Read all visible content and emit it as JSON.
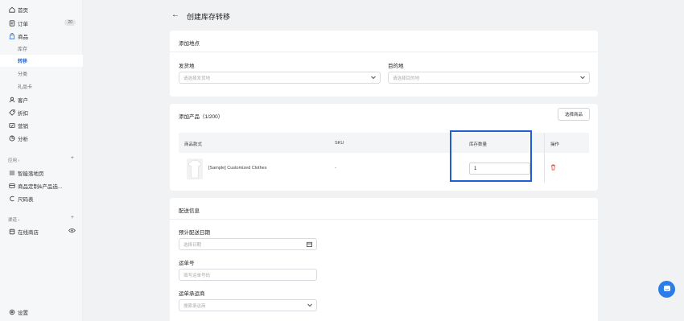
{
  "sidebar": {
    "items": [
      {
        "label": "首页",
        "icon": "home-icon"
      },
      {
        "label": "订单",
        "icon": "order-icon",
        "badge": "20"
      },
      {
        "label": "商品",
        "icon": "product-icon"
      },
      {
        "label": "库存"
      },
      {
        "label": "转移"
      },
      {
        "label": "分类"
      },
      {
        "label": "礼品卡"
      },
      {
        "label": "客户",
        "icon": "customer-icon"
      },
      {
        "label": "折扣",
        "icon": "discount-icon"
      },
      {
        "label": "营销",
        "icon": "marketing-icon"
      },
      {
        "label": "分析",
        "icon": "analytics-icon"
      }
    ],
    "apps_label": "应用 ›",
    "apps": [
      {
        "label": "智能落地页",
        "icon": "landing-page-icon"
      },
      {
        "label": "商品定制&产品选...",
        "icon": "customize-icon"
      },
      {
        "label": "尺码表",
        "icon": "size-chart-icon"
      }
    ],
    "channels_label": "渠道 ›",
    "channels": [
      {
        "label": "在线商店",
        "icon": "store-icon"
      }
    ],
    "settings_label": "设置",
    "active_color": "#1f6ee8"
  },
  "header": {
    "title": "创建库存转移"
  },
  "locations": {
    "title": "添加地点",
    "origin_label": "发货地",
    "origin_placeholder": "请选择发货地",
    "destination_label": "目的地",
    "destination_placeholder": "请选择目的地"
  },
  "products": {
    "title": "添加产品（1/200）",
    "select_button": "选择商品",
    "columns": [
      "商品款式",
      "SKU",
      "库存数量",
      "操作"
    ],
    "rows": [
      {
        "name": "[Sample] Customized Clothes",
        "sku": "-",
        "quantity": "1"
      }
    ]
  },
  "shipping": {
    "title": "配送信息",
    "date_label": "预计配送日期",
    "date_placeholder": "选择日期",
    "tracking_label": "运单号",
    "tracking_placeholder": "填写运单号码",
    "carrier_label": "运单承运商",
    "carrier_placeholder": "搜索承运商"
  }
}
